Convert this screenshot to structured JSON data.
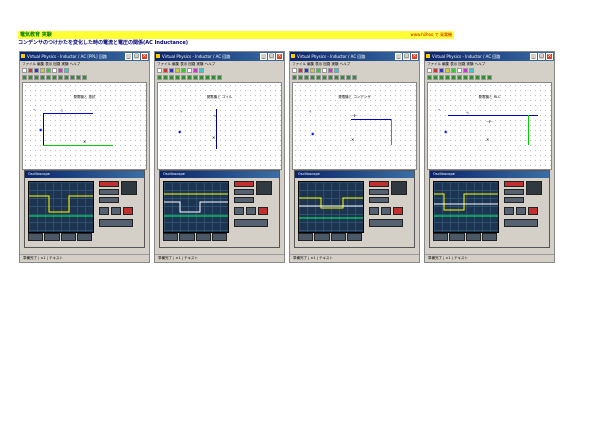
{
  "header": {
    "left_text": "電気教育 実験",
    "right_text": "www.hiihoo で 発電機",
    "subtitle": "コンデンサのつけかたを変化した時の電流と電圧の関係(AC Inductance)"
  },
  "windows": [
    {
      "title": "Virtual Physics - Inductor / AC  [PPL]  回路",
      "menu": "ファイル  編集  表示  回路  実験  ヘルプ",
      "canvas_title": "発電機と 抵抗",
      "scope_title": "Oscilloscope",
      "status": "準備完了  |  ×1  |  テキスト"
    },
    {
      "title": "Virtual Physics - Inductor / AC  回路",
      "menu": "ファイル  編集  表示  回路  実験  ヘルプ",
      "canvas_title": "発電機と コイル",
      "scope_title": "Oscilloscope",
      "status": "準備完了  |  ×1  |  テキスト"
    },
    {
      "title": "Virtual Physics - Inductor / AC  回路",
      "menu": "ファイル  編集  表示  回路  実験  ヘルプ",
      "canvas_title": "発電機と コンデンサ",
      "scope_title": "Oscilloscope",
      "status": "準備完了  |  ×1  |  テキスト"
    },
    {
      "title": "Virtual Physics - Inductor / AC  回路",
      "menu": "ファイル  編集  表示  回路  実験  ヘルプ",
      "canvas_title": "発電機と RLC",
      "scope_title": "Oscilloscope",
      "status": "準備完了  |  ×1  |  テキスト"
    }
  ],
  "colors": {
    "title_bar": "#0a246a",
    "header_bg": "#ffff33",
    "scope_bg": "#1c3450",
    "trace_yellow": "#ffff00",
    "trace_green": "#00ff66",
    "trace_white": "#ffffff"
  }
}
